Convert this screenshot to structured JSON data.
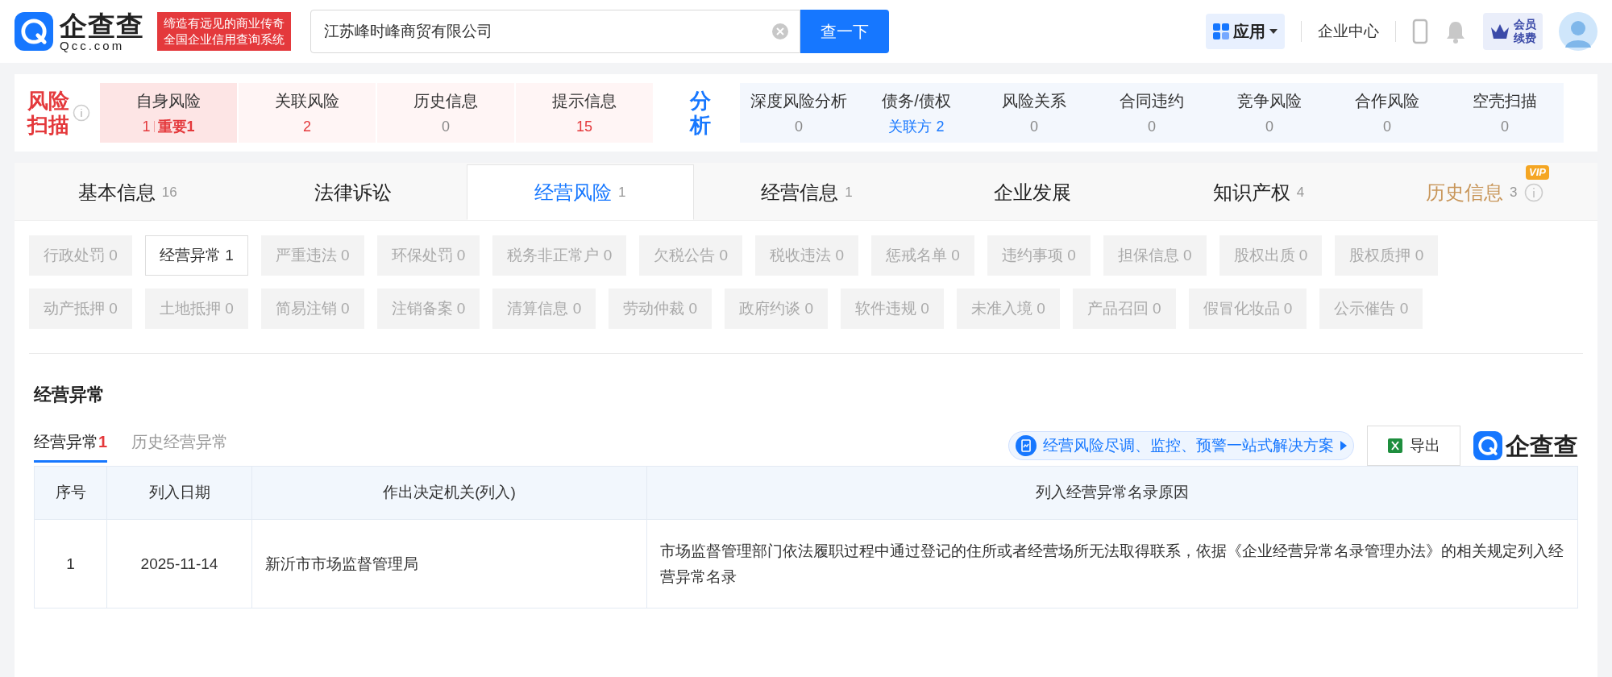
{
  "header": {
    "logo_text": "企查查",
    "logo_domain": "Qcc.com",
    "slogan_lines": [
      "缔造有远见的商业传奇",
      "全国企业信用查询系统"
    ],
    "search": {
      "value": "江苏峰时峰商贸有限公司"
    },
    "search_button": "查一下",
    "apps_button": "应用",
    "enterprise_center": "企业中心",
    "member_badge": [
      "会员",
      "续费"
    ]
  },
  "risk_scan": {
    "title": [
      "风险",
      "扫描"
    ],
    "items": [
      {
        "label": "自身风险",
        "value": "1",
        "important": "重要1",
        "selected": true,
        "alert": true
      },
      {
        "label": "关联风险",
        "value": "2",
        "selected": false,
        "alert": true
      },
      {
        "label": "历史信息",
        "value": "0",
        "selected": false,
        "alert": false
      },
      {
        "label": "提示信息",
        "value": "15",
        "selected": false,
        "alert": true
      }
    ]
  },
  "analysis": {
    "title": [
      "分",
      "析"
    ],
    "items": [
      {
        "label": "深度风险分析",
        "value": "0",
        "link": false
      },
      {
        "label": "债务/债权",
        "value": "关联方 2",
        "link": true
      },
      {
        "label": "风险关系",
        "value": "0",
        "link": false
      },
      {
        "label": "合同违约",
        "value": "0",
        "link": false
      },
      {
        "label": "竞争风险",
        "value": "0",
        "link": false
      },
      {
        "label": "合作风险",
        "value": "0",
        "link": false
      },
      {
        "label": "空壳扫描",
        "value": "0",
        "link": false
      }
    ]
  },
  "main_tabs": [
    {
      "label": "基本信息",
      "count": "16",
      "selected": false,
      "kind": "normal"
    },
    {
      "label": "法律诉讼",
      "selected": false,
      "kind": "normal"
    },
    {
      "label": "经营风险",
      "count": "1",
      "selected": true,
      "kind": "normal"
    },
    {
      "label": "经营信息",
      "count": "1",
      "selected": false,
      "kind": "normal"
    },
    {
      "label": "企业发展",
      "selected": false,
      "kind": "normal"
    },
    {
      "label": "知识产权",
      "count": "4",
      "selected": false,
      "kind": "normal"
    },
    {
      "label": "历史信息",
      "count": "3",
      "selected": false,
      "kind": "vip",
      "badge": "VIP"
    }
  ],
  "filter_rows": [
    [
      {
        "label": "行政处罚 0",
        "selected": false
      },
      {
        "label": "经营异常 1",
        "selected": true
      },
      {
        "label": "严重违法 0",
        "selected": false
      },
      {
        "label": "环保处罚 0",
        "selected": false
      },
      {
        "label": "税务非正常户 0",
        "selected": false
      },
      {
        "label": "欠税公告 0",
        "selected": false
      },
      {
        "label": "税收违法 0",
        "selected": false
      },
      {
        "label": "惩戒名单 0",
        "selected": false
      },
      {
        "label": "违约事项 0",
        "selected": false
      },
      {
        "label": "担保信息 0",
        "selected": false
      },
      {
        "label": "股权出质 0",
        "selected": false
      },
      {
        "label": "股权质押 0",
        "selected": false
      }
    ],
    [
      {
        "label": "动产抵押 0",
        "selected": false
      },
      {
        "label": "土地抵押 0",
        "selected": false
      },
      {
        "label": "简易注销 0",
        "selected": false
      },
      {
        "label": "注销备案 0",
        "selected": false
      },
      {
        "label": "清算信息 0",
        "selected": false
      },
      {
        "label": "劳动仲裁 0",
        "selected": false
      },
      {
        "label": "政府约谈 0",
        "selected": false
      },
      {
        "label": "软件违规 0",
        "selected": false
      },
      {
        "label": "未准入境 0",
        "selected": false
      },
      {
        "label": "产品召回 0",
        "selected": false
      },
      {
        "label": "假冒化妆品 0",
        "selected": false
      },
      {
        "label": "公示催告 0",
        "selected": false
      }
    ]
  ],
  "section": {
    "title": "经营异常",
    "sub_tabs": [
      {
        "label": "经营异常",
        "count": "1",
        "selected": true
      },
      {
        "label": "历史经营异常",
        "selected": false
      }
    ],
    "promo_link": "经营风险尽调、监控、预警一站式解决方案",
    "export_button": "导出",
    "brand": "企查查"
  },
  "table": {
    "columns": [
      "序号",
      "列入日期",
      "作出决定机关(列入)",
      "列入经营异常名录原因"
    ],
    "rows": [
      [
        "1",
        "2025-11-14",
        "新沂市市场监督管理局",
        "市场监督管理部门依法履职过程中通过登记的住所或者经营场所无法取得联系，依据《企业经营异常名录管理办法》的相关规定列入经营异常名录"
      ]
    ]
  }
}
